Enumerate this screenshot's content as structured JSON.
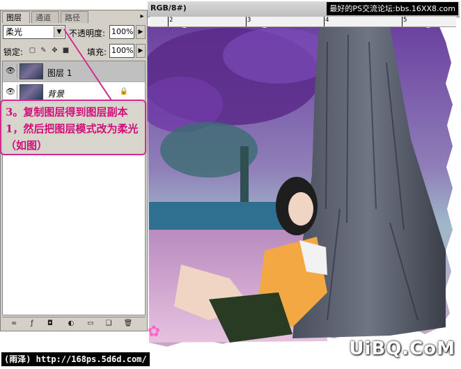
{
  "window": {
    "title_fragment": "RGB/8#)",
    "site_label": "最好的PS交流论坛:bbs.16XX8.com"
  },
  "ruler": {
    "labels": [
      "2",
      "3",
      "4",
      "5"
    ]
  },
  "panel": {
    "tabs": [
      "图层",
      "通道",
      "路径"
    ],
    "menu_arrow": "▸",
    "blend_mode": "柔光",
    "opacity_label": "不透明度:",
    "opacity_value": "100%",
    "lock_label": "锁定:",
    "fill_label": "填充:",
    "fill_value": "100%",
    "layers": [
      {
        "name": "图层 1",
        "selected": true
      },
      {
        "name": "背景",
        "selected": false,
        "locked": true
      }
    ],
    "bottom_icons": [
      "link-icon",
      "fx-icon",
      "mask-icon",
      "adjustment-icon",
      "folder-icon",
      "new-layer-icon",
      "trash-icon"
    ]
  },
  "callout": {
    "text": "3。复制图层得到图层副本1，然后把图层模式改为柔光（如图）"
  },
  "watermarks": {
    "left": "(雨泽) http://168ps.5d6d.com/",
    "right": "UiBQ.CoM"
  }
}
